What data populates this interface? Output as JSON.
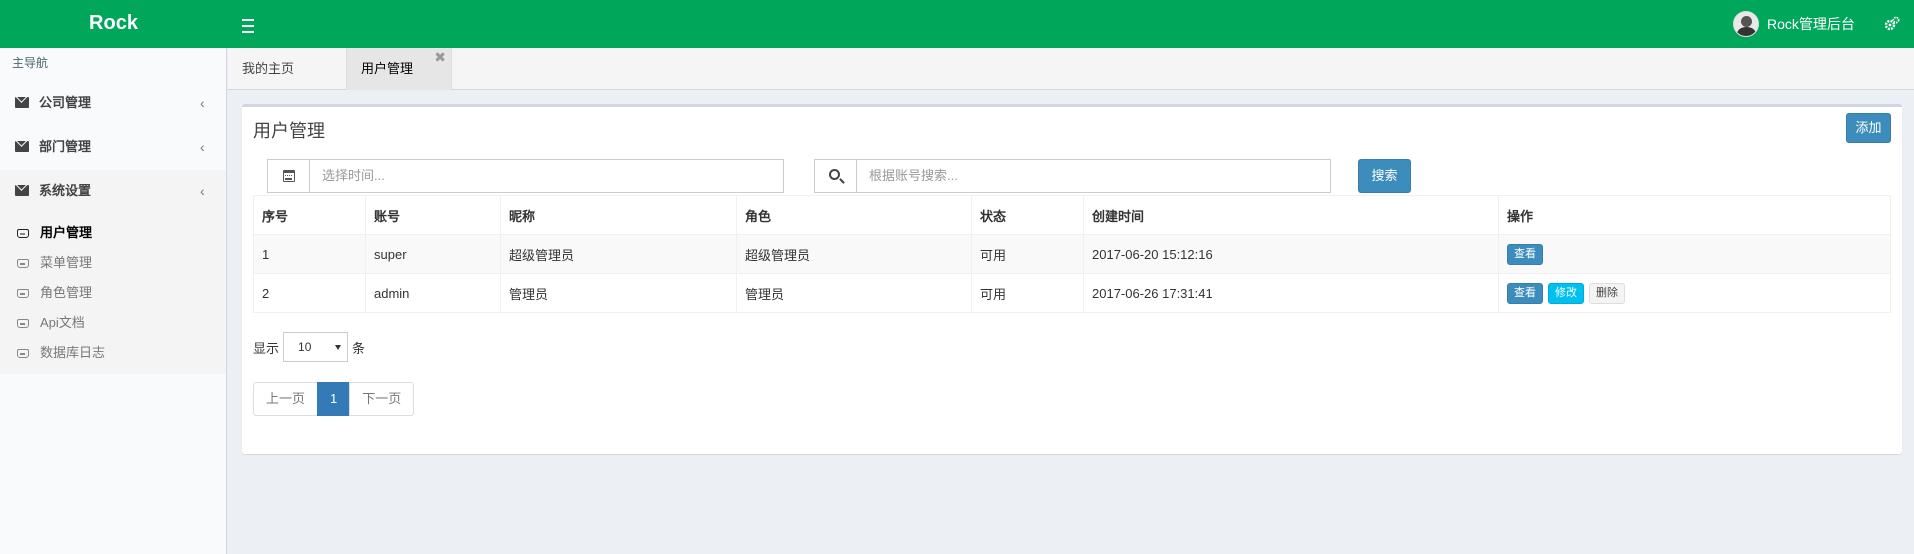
{
  "header": {
    "logo": "Rock",
    "user_name": "Rock管理后台",
    "color": "#00a65a"
  },
  "sidebar": {
    "heading": "主导航",
    "groups": [
      {
        "label": "公司管理"
      },
      {
        "label": "部门管理"
      },
      {
        "label": "系统设置"
      }
    ],
    "sub_items": [
      {
        "label": "用户管理",
        "active": true
      },
      {
        "label": "菜单管理"
      },
      {
        "label": "角色管理"
      },
      {
        "label": "Api文档"
      },
      {
        "label": "数据库日志"
      }
    ]
  },
  "tabs": [
    {
      "label": "我的主页"
    },
    {
      "label": "用户管理",
      "active": true
    }
  ],
  "box": {
    "title": "用户管理",
    "add_label": "添加",
    "date_placeholder": "选择时间...",
    "search_placeholder": "根据账号搜索...",
    "search_label": "搜索"
  },
  "table": {
    "headers": [
      "序号",
      "账号",
      "昵称",
      "角色",
      "状态",
      "创建时间",
      "操作"
    ],
    "rows": [
      {
        "no": "1",
        "account": "super",
        "nickname": "超级管理员",
        "role": "超级管理员",
        "status": "可用",
        "created": "2017-06-20 15:12:16"
      },
      {
        "no": "2",
        "account": "admin",
        "nickname": "管理员",
        "role": "管理员",
        "status": "可用",
        "created": "2017-06-26 17:31:41"
      }
    ],
    "actions": {
      "view": "查看",
      "edit": "修改",
      "delete": "删除"
    }
  },
  "length": {
    "prefix": "显示",
    "value": "10",
    "suffix": "条"
  },
  "pagination": {
    "prev": "上一页",
    "current": "1",
    "next": "下一页"
  }
}
